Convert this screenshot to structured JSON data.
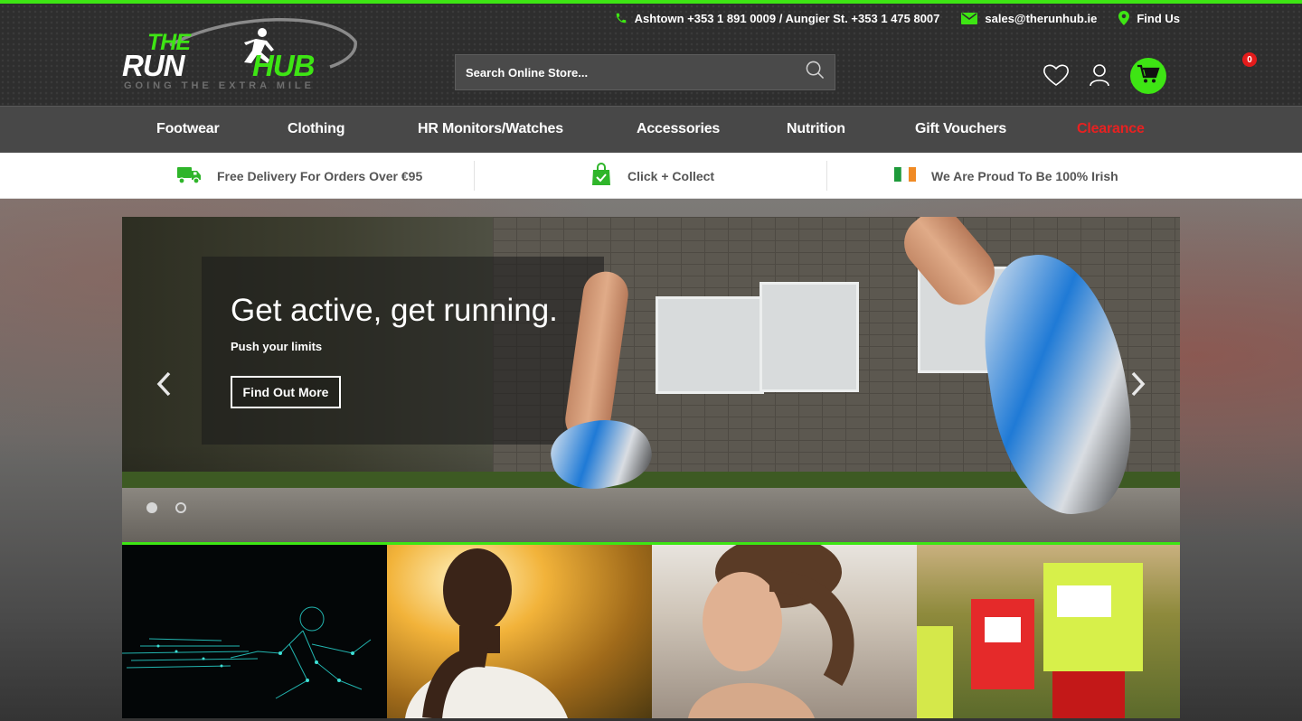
{
  "header": {
    "contact": {
      "phones": "Ashtown +353 1 891 0009 / Aungier St. +353 1 475 8007",
      "email": "sales@therunhub.ie",
      "find_us": "Find Us"
    },
    "logo": {
      "line1": "THE",
      "run": "RUN",
      "hub": "HUB",
      "tagline": "GOING THE EXTRA MILE"
    },
    "search": {
      "placeholder": "Search Online Store..."
    },
    "cart": {
      "count": "0"
    },
    "icons": [
      "phone-icon",
      "mail-icon",
      "map-pin-icon",
      "search-icon",
      "heart-icon",
      "user-icon",
      "cart-icon"
    ]
  },
  "nav": {
    "items": [
      {
        "label": "Footwear"
      },
      {
        "label": "Clothing"
      },
      {
        "label": "HR Monitors/Watches"
      },
      {
        "label": "Accessories"
      },
      {
        "label": "Nutrition"
      },
      {
        "label": "Gift Vouchers"
      },
      {
        "label": "Clearance"
      }
    ]
  },
  "benefits": [
    {
      "icon": "delivery-truck-icon",
      "label": "Free Delivery For Orders Over €95"
    },
    {
      "icon": "shopping-bag-icon",
      "label": "Click + Collect"
    },
    {
      "icon": "irish-flag-icon",
      "label": "We Are Proud To Be 100% Irish"
    }
  ],
  "hero": {
    "title": "Get active, get running.",
    "subtitle": "Push your limits",
    "button_label": "Find Out More",
    "slide_count": 2,
    "active_slide": 1
  },
  "tiles": [
    {
      "name": "digital-runner"
    },
    {
      "name": "male-runner"
    },
    {
      "name": "female-runner"
    },
    {
      "name": "race-runners"
    }
  ],
  "colors": {
    "accent": "#3ee514",
    "header_bg": "#2e2e2e",
    "nav_bg": "#484848",
    "clearance": "#e82121",
    "cart_badge": "#e41b1b"
  }
}
